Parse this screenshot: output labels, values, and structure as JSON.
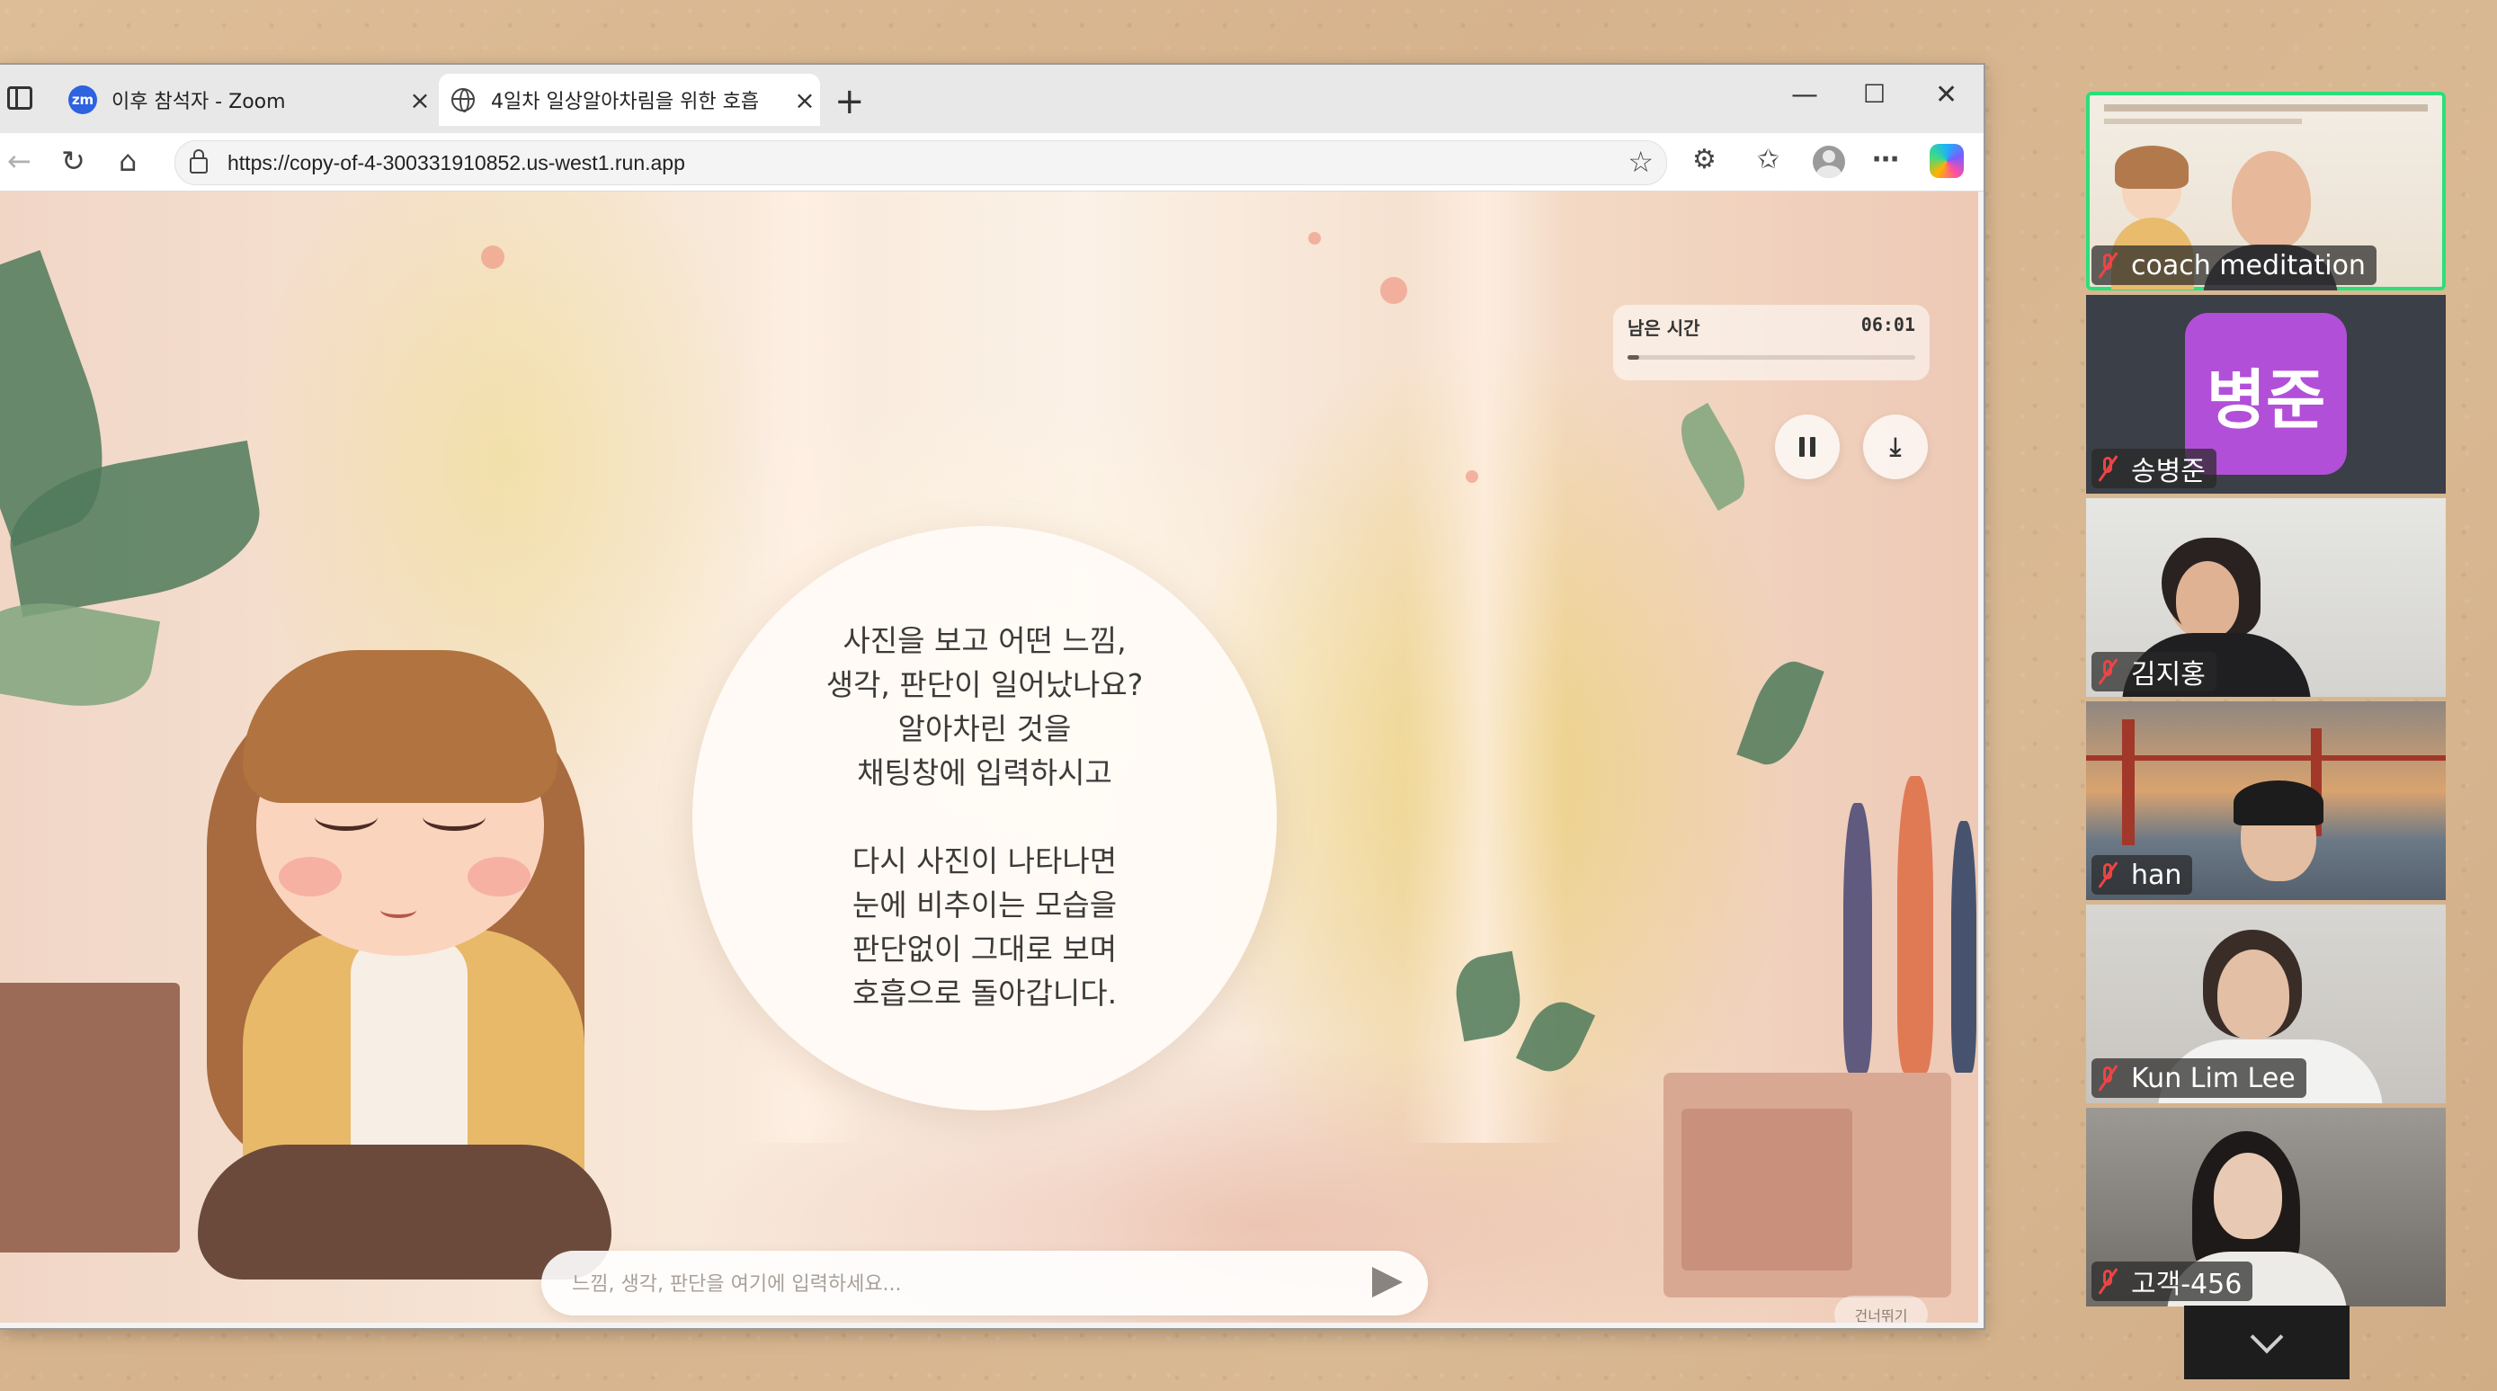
{
  "browser": {
    "tabs": [
      {
        "title": "이후 참석자 - Zoom",
        "active": false,
        "icon": "zoom-icon",
        "badge": "zm"
      },
      {
        "title": "4일차 일상알아차림을 위한 호흡",
        "active": true,
        "icon": "globe-icon"
      }
    ],
    "new_tab_glyph": "+",
    "window_controls": {
      "minimize": "—",
      "maximize": "☐",
      "close": "✕"
    },
    "url": "https://copy-of-4-300331910852.us-west1.run.app"
  },
  "page": {
    "timer": {
      "label": "남은 시간",
      "value": "06:01",
      "progress": 0.04
    },
    "instructions": [
      "사진을 보고 어떤 느낌,\n생각, 판단이 일어났나요?\n알아차린 것을\n채팅창에 입력하시고",
      "다시 사진이 나타나면\n눈에 비추이는 모습을\n판단없이 그대로 보며\n호흡으로 돌아갑니다."
    ],
    "chat_placeholder": "느낌, 생각, 판단을 여기에 입력하세요...",
    "skip_label": "건너뛰기"
  },
  "participants": [
    {
      "name": "coach meditation",
      "active_speaker": true,
      "muted": true
    },
    {
      "name": "송병준",
      "initials": "병준",
      "muted": true,
      "avatar_color": "#b24fd8"
    },
    {
      "name": "김지홍",
      "muted": true
    },
    {
      "name": "han",
      "muted": true
    },
    {
      "name": "Kun Lim Lee",
      "muted": true
    },
    {
      "name": "고객-456",
      "muted": true
    }
  ],
  "colors": {
    "active_speaker": "#29e07a",
    "muted_mic": "#e44444",
    "zoom_blue": "#2d62e0"
  }
}
